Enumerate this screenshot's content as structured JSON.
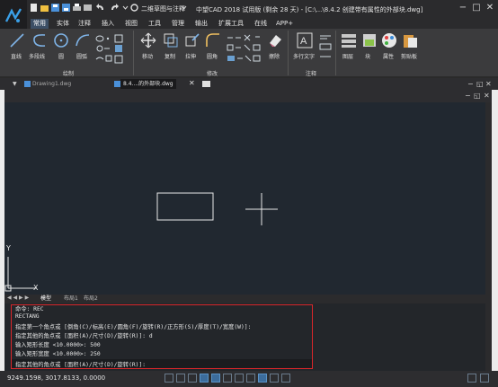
{
  "app": {
    "title": "中望CAD 2018 试用版 (剩余 28 天) - [C:\\...\\8.4.2  创建带有属性的外部块.dwg]",
    "workspace": "二维草图与注释"
  },
  "menu": [
    "常用",
    "实体",
    "注释",
    "插入",
    "视图",
    "工具",
    "管理",
    "输出",
    "扩展工具",
    "在线",
    "APP+"
  ],
  "ribbon": {
    "draw": {
      "title": "绘制",
      "line": "直线",
      "polyline": "多段线",
      "circle": "圆",
      "arc": "圆弧"
    },
    "modify": {
      "title": "修改",
      "move": "移动",
      "copy": "复制",
      "stretch": "拉伸",
      "fillet": "圆角",
      "erase": "擦除"
    },
    "annotation": {
      "title": "注释",
      "mtext": "多行文字"
    },
    "layers": {
      "label": "图层"
    },
    "block": {
      "label": "块"
    },
    "properties": {
      "label": "属性"
    },
    "clipboard": {
      "label": "剪贴板"
    }
  },
  "doc_tabs": [
    "Drawing1.dwg",
    "8.4....的外部块.dwg"
  ],
  "layout_tabs": [
    "模型",
    "布局1",
    "布局2"
  ],
  "ucs": {
    "x_label": "X",
    "y_label": "Y"
  },
  "command": {
    "lines": [
      "命令: REC",
      "RECTANG",
      "指定第一个角点或 [倒角(C)/标高(E)/圆角(F)/旋转(R)/正方形(S)/厚度(T)/宽度(W)]:",
      "指定其他的角点或 [面积(A)/尺寸(D)/旋转(R)]: d",
      "输入矩形长度 <10.0000>: 500",
      "输入矩形宽度 <10.0000>: 250"
    ],
    "prompt": "指定其他的角点或 [面积(A)/尺寸(D)/旋转(R)]:"
  },
  "status": {
    "coords": "9249.1598, 3017.8133, 0.0000"
  },
  "colors": {
    "canvas": "#212830",
    "accent": "#3c4f66",
    "highlight": "#d9262a"
  }
}
